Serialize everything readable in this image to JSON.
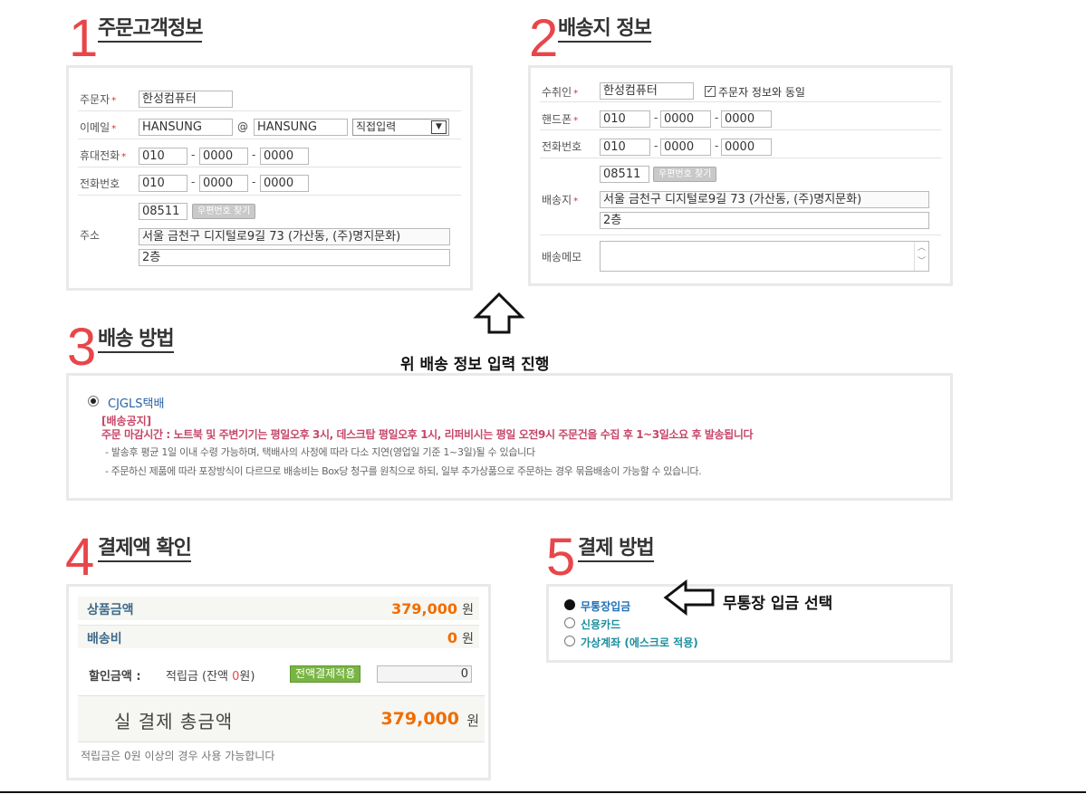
{
  "sec1": {
    "num": "1",
    "title": "주문고객정보",
    "orderer_label": "주문자",
    "orderer_value": "한성컴퓨터",
    "email_label": "이메일",
    "email_id": "HANSUNG",
    "email_at": "@",
    "email_domain": "HANSUNG",
    "email_select": "직접입력",
    "mobile_label": "휴대전화",
    "mobile": [
      "010",
      "0000",
      "0000"
    ],
    "phone_label": "전화번호",
    "phone": [
      "010",
      "0000",
      "0000"
    ],
    "address_label": "주소",
    "zipcode": "08511",
    "zip_button": "우편번호 찾기",
    "address1": "서울 금천구 디지털로9길 73 (가산동, (주)명지문화)",
    "address2": "2층",
    "dash": "-",
    "req": "*"
  },
  "sec2": {
    "num": "2",
    "title": "배송지 정보",
    "receiver_label": "수취인",
    "receiver_value": "한성컴퓨터",
    "same_check_label": "주문자 정보와 동일",
    "mobile_label": "핸드폰",
    "mobile": [
      "010",
      "0000",
      "0000"
    ],
    "phone_label": "전화번호",
    "phone": [
      "010",
      "0000",
      "0000"
    ],
    "address_label": "배송지",
    "zipcode": "08511",
    "zip_button": "우편번호 찾기",
    "address1": "서울 금천구 디지털로9길 73 (가산동, (주)명지문화)",
    "address2": "2층",
    "memo_label": "배송메모"
  },
  "arrow_note_up": "위 배송 정보 입력 진행",
  "sec3": {
    "num": "3",
    "title": "배송 방법",
    "option": "CJGLS택배",
    "notice_title": "[배송공지]",
    "notice_main": "주문 마감시간 : 노트북 및 주변기기는 평일오후 3시, 데스크탑 평일오후 1시, 리퍼비시는 평일 오전9시 주문건을 수집 후 1~3일소요 후 발송됩니다",
    "notice_1": "- 발송후 평균 1일 이내 수령 가능하며, 택배사의 사정에 따라 다소 지연(영업일 기준 1~3일)될 수 있습니다",
    "notice_2": "- 주문하신 제품에 따라 포장방식이 다르므로 배송비는 Box당 청구를 원칙으로 하되, 일부 추가상품으로 주문하는 경우 묶음배송이 가능할 수 있습니다."
  },
  "sec4": {
    "num": "4",
    "title": "결제액 확인",
    "goods_label": "상품금액",
    "goods_value": "379,000",
    "ship_label": "배송비",
    "ship_value": "0",
    "won": "원",
    "discount_label": "할인금액 :",
    "points_label_pre": "적립금 (잔액 ",
    "points_balance": "0",
    "points_label_post": "원)",
    "apply_all_button": "전액결제적용",
    "points_input": "0",
    "total_label": "실 결제 총금액",
    "total_value": "379,000",
    "points_note": "적립금은 0원 이상의 경우 사용 가능합니다"
  },
  "sec5": {
    "num": "5",
    "title": "결제 방법",
    "options": [
      "무통장입금",
      "신용카드",
      "가상계좌 (에스크로 적용)"
    ]
  },
  "arrow_note_left": "무통장 입금 선택"
}
